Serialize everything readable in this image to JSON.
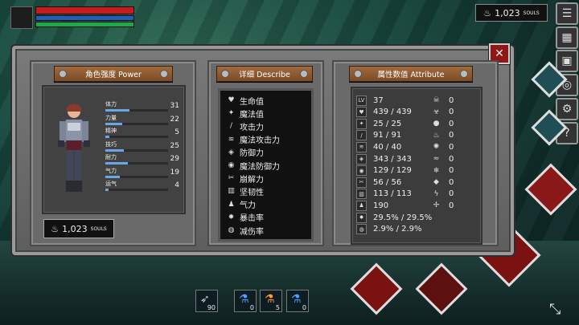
{
  "hud": {
    "souls_top": "1,023",
    "souls_label": "SOULS"
  },
  "power": {
    "title": "角色强度 Power",
    "stats": [
      {
        "name": "体力",
        "value": "31",
        "fill": 0.38
      },
      {
        "name": "力量",
        "value": "22",
        "fill": 0.27
      },
      {
        "name": "精神",
        "value": "5",
        "fill": 0.06
      },
      {
        "name": "技巧",
        "value": "25",
        "fill": 0.3
      },
      {
        "name": "耐力",
        "value": "29",
        "fill": 0.36
      },
      {
        "name": "气力",
        "value": "19",
        "fill": 0.23
      },
      {
        "name": "运气",
        "value": "4",
        "fill": 0.05
      }
    ],
    "souls": "1,023",
    "souls_label": "SOULS"
  },
  "describe": {
    "title": "详细 Describe",
    "items": [
      "生命值",
      "魔法值",
      "攻击力",
      "魔法攻击力",
      "防御力",
      "魔法防御力",
      "崩解力",
      "坚韧性",
      "气力",
      "暴击率",
      "减伤率"
    ]
  },
  "attribute": {
    "title": "属性数值 Attribute",
    "left": [
      {
        "icon": "level-icon",
        "glyph": "LV",
        "value": "37"
      },
      {
        "icon": "heart-icon",
        "glyph": "♥",
        "value": "439 / 439"
      },
      {
        "icon": "mana-icon",
        "glyph": "✦",
        "value": "25 / 25"
      },
      {
        "icon": "sword-icon",
        "glyph": "/",
        "value": "91 / 91"
      },
      {
        "icon": "magic-attack-icon",
        "glyph": "≋",
        "value": "40 / 40"
      },
      {
        "icon": "shield-icon",
        "glyph": "◈",
        "value": "343 / 343"
      },
      {
        "icon": "magic-shield-icon",
        "glyph": "◉",
        "value": "129 / 129"
      },
      {
        "icon": "break-icon",
        "glyph": "✂",
        "value": "56 / 56"
      },
      {
        "icon": "toughness-icon",
        "glyph": "▥",
        "value": "113 / 113"
      },
      {
        "icon": "stamina-icon",
        "glyph": "♟",
        "value": "190"
      },
      {
        "icon": "crit-icon",
        "glyph": "✸",
        "value": "29.5% / 29.5%"
      },
      {
        "icon": "reduction-icon",
        "glyph": "◍",
        "value": "2.9% / 2.9%"
      }
    ],
    "right": [
      {
        "icon": "skull-icon",
        "glyph": "☠",
        "value": "0"
      },
      {
        "icon": "poison-icon",
        "glyph": "☣",
        "value": "0"
      },
      {
        "icon": "water-icon",
        "glyph": "●",
        "value": "0"
      },
      {
        "icon": "fire-icon",
        "glyph": "♨",
        "value": "0"
      },
      {
        "icon": "flame-icon",
        "glyph": "✺",
        "value": "0"
      },
      {
        "icon": "wind-icon",
        "glyph": "≈",
        "value": "0"
      },
      {
        "icon": "ice-icon",
        "glyph": "❄",
        "value": "0"
      },
      {
        "icon": "earth-icon",
        "glyph": "◆",
        "value": "0"
      },
      {
        "icon": "lightning-icon",
        "glyph": "ϟ",
        "value": "0"
      },
      {
        "icon": "bleed-icon",
        "glyph": "✢",
        "value": "0"
      }
    ]
  },
  "quickbar": [
    {
      "name": "arrow-slot",
      "glyph": "➶",
      "count": "90"
    },
    {
      "name": "blue-potion-slot",
      "glyph": "⚗",
      "count": "0"
    },
    {
      "name": "orange-potion-slot",
      "glyph": "⚗",
      "count": "5"
    },
    {
      "name": "blue-flask-slot",
      "glyph": "⚗",
      "count": "0"
    }
  ],
  "colors": {
    "hp": "#c81b1b",
    "mp": "#1f5fb8",
    "stamina": "#1fa84a",
    "plank": "#8a5530",
    "accent_red": "#8e1717"
  }
}
